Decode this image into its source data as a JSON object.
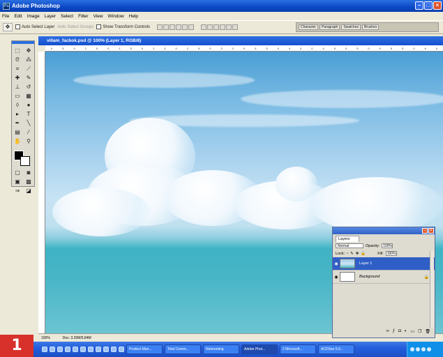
{
  "window": {
    "title": "Adobe Photoshop",
    "app_icon": "Ps"
  },
  "menu": [
    "File",
    "Edit",
    "Image",
    "Layer",
    "Select",
    "Filter",
    "View",
    "Window",
    "Help"
  ],
  "options": {
    "auto_select": "Auto Select Layer",
    "auto_select_dim": "Auto Select Groups",
    "transform": "Show Transform Controls",
    "palette_tabs": [
      "Character",
      "Paragraph",
      "Swatches",
      "Brushes"
    ]
  },
  "document": {
    "title": "villam_facbok.psd @ 100% (Layer 1, RGB/8)",
    "ruler_marks": [
      "0",
      "50",
      "100",
      "150",
      "200",
      "250",
      "300",
      "350",
      "400",
      "450",
      "500",
      "550",
      "600",
      "650",
      "700",
      "750",
      "800",
      "850",
      "900",
      "950",
      "1000"
    ],
    "status_zoom": "100%",
    "status_doc": "Doc: 3.29M/5.84M"
  },
  "layers_panel": {
    "tab": "Layers",
    "blend_mode": "Normal",
    "opacity_label": "Opacity:",
    "opacity": "100%",
    "lock_label": "Lock:",
    "fill_label": "Fill:",
    "fill": "100%",
    "layers": [
      {
        "name": "Layer 1",
        "active": true
      },
      {
        "name": "Background",
        "active": false
      }
    ]
  },
  "taskbar": {
    "tasks": [
      "Product Man...",
      "Total Comm...",
      "Netmeeting",
      "Adobe Phot...",
      "2 Microsoft...",
      "ACDSee 5.0..."
    ],
    "active_index": 3
  },
  "badge": "1",
  "colors": {
    "title_bar": "#0b48c5",
    "taskbar": "#245edb",
    "selection": "#2f5fc6",
    "badge": "#d8312b"
  }
}
